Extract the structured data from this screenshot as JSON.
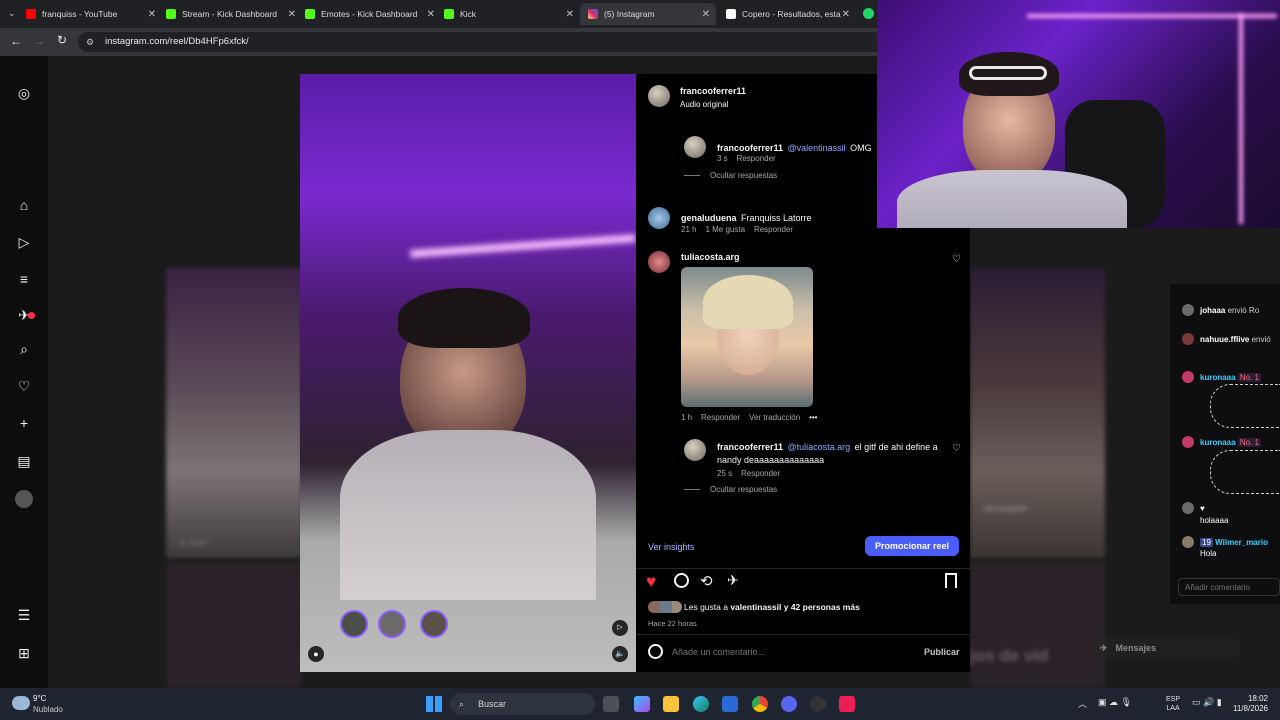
{
  "browser": {
    "tabs": [
      {
        "title": "franquiss - YouTube",
        "color": "#ff0000"
      },
      {
        "title": "Stream - Kick Dashboard",
        "color": "#53fc18"
      },
      {
        "title": "Emotes - Kick Dashboard",
        "color": "#53fc18"
      },
      {
        "title": "Kick",
        "color": "#53fc18"
      },
      {
        "title": "(5) Instagram",
        "color": "#d62976"
      },
      {
        "title": "Copero - Resultados, esta",
        "color": "#ffffff"
      }
    ],
    "url": "instagram.com/reel/Db4HFp6xfck/"
  },
  "post": {
    "author": "francooferrer11",
    "audio": "Audio original",
    "comments": [
      {
        "user": "francooferrer11",
        "mention": "@valentinassil",
        "text": "OMG",
        "time": "3 s",
        "reply": "Responder",
        "hide": "Ocultar respuestas"
      },
      {
        "user": "genaluduena",
        "text": "Franquiss Latorre",
        "time": "21 h",
        "likes": "1 Me gusta",
        "reply": "Responder"
      },
      {
        "user": "tuliacosta.arg",
        "time": "1 h",
        "reply": "Responder",
        "translate": "Ver traducción"
      },
      {
        "user": "francooferrer11",
        "mention": "@tuliacosta.arg",
        "text": "el gitf de ahi define a nandy deaaaaaaaaaaaaaa",
        "time": "25 s",
        "reply": "Responder",
        "hide": "Ocultar respuestas"
      }
    ],
    "insights": "Ver insights",
    "promote": "Promocionar reel",
    "likes_prefix": "Les gusta a",
    "likes_user": "valentinassil",
    "likes_rest": "y 42 personas más",
    "posted": "Hace 22 horas",
    "comment_placeholder": "Añade un comentario...",
    "publish": "Publicar",
    "bg_count": "2097",
    "bg_overlay": "descargable",
    "bg_bottom": "jos de vid"
  },
  "chat": {
    "lines": [
      {
        "user": "johaaa",
        "text": "envió Ro",
        "badge": "",
        "color": "#ffffff"
      },
      {
        "user": "nahuue.fflive",
        "text": "envió",
        "badge": "",
        "color": "#ffffff"
      },
      {
        "user": "kuronaaa",
        "text": "",
        "badge": "No. 1",
        "color": "#3ad1ff"
      },
      {
        "user": "kuronaaa",
        "text": "",
        "badge": "No. 1",
        "color": "#3ad1ff"
      },
      {
        "user": "",
        "text": "holaaaa",
        "badge": "",
        "color": "#ffffff"
      },
      {
        "user": "Wilmer_mario",
        "text": "Hola",
        "badge": "19",
        "color": "#3ad1ff"
      }
    ],
    "input_placeholder": "Añadir comentario",
    "messages_label": "Mensajes"
  },
  "taskbar": {
    "weather_temp": "9°C",
    "weather_desc": "Nublado",
    "search": "Buscar",
    "lang_top": "ESP",
    "lang_bottom": "LAA",
    "time": "18:02",
    "date": "11/8/2026"
  }
}
